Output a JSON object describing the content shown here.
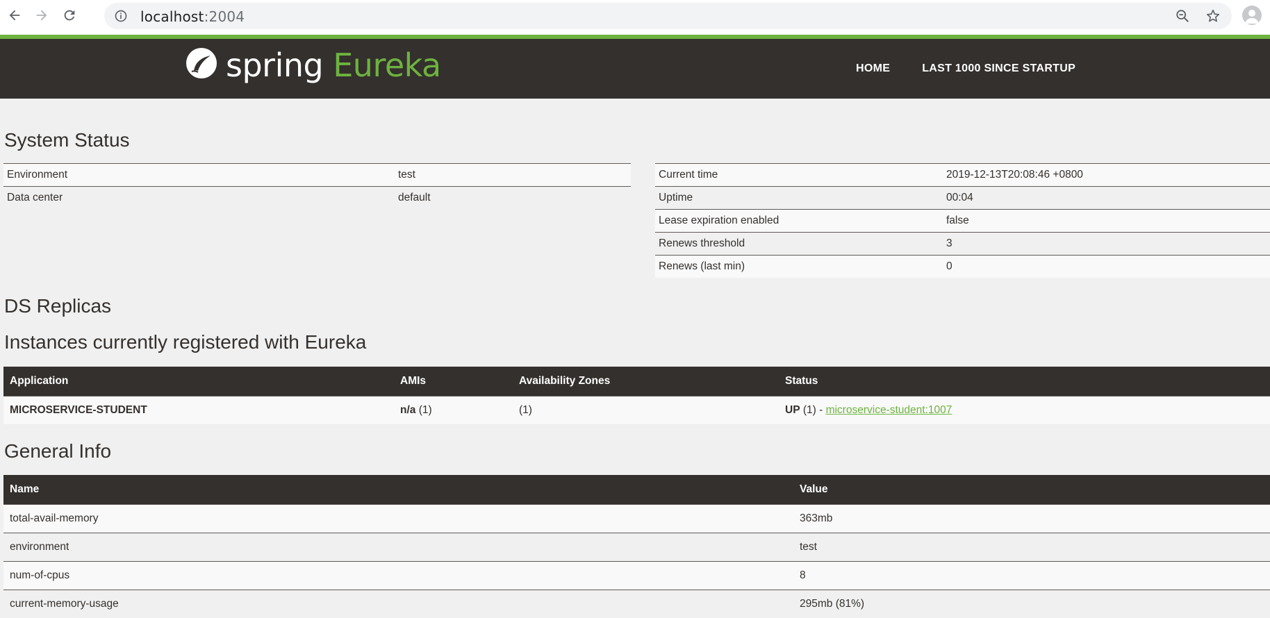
{
  "browser": {
    "url_host": "localhost",
    "url_port": ":2004"
  },
  "navbar": {
    "brand_spring": "spring",
    "brand_eureka": "Eureka",
    "links": [
      "HOME",
      "LAST 1000 SINCE STARTUP"
    ]
  },
  "system_status": {
    "title": "System Status",
    "left": [
      {
        "label": "Environment",
        "value": "test"
      },
      {
        "label": "Data center",
        "value": "default"
      }
    ],
    "right": [
      {
        "label": "Current time",
        "value": "2019-12-13T20:08:46 +0800"
      },
      {
        "label": "Uptime",
        "value": "00:04"
      },
      {
        "label": "Lease expiration enabled",
        "value": "false"
      },
      {
        "label": "Renews threshold",
        "value": "3"
      },
      {
        "label": "Renews (last min)",
        "value": "0"
      }
    ]
  },
  "ds_replicas": {
    "title": "DS Replicas"
  },
  "instances": {
    "title": "Instances currently registered with Eureka",
    "headers": [
      "Application",
      "AMIs",
      "Availability Zones",
      "Status"
    ],
    "rows": [
      {
        "application": "MICROSERVICE-STUDENT",
        "ami_bold": "n/a",
        "ami_count": " (1)",
        "zones": "(1)",
        "status_bold": "UP",
        "status_rest": " (1) - ",
        "status_link": "microservice-student:1007"
      }
    ]
  },
  "general_info": {
    "title": "General Info",
    "headers": [
      "Name",
      "Value"
    ],
    "rows": [
      {
        "name": "total-avail-memory",
        "value": "363mb"
      },
      {
        "name": "environment",
        "value": "test"
      },
      {
        "name": "num-of-cpus",
        "value": "8"
      },
      {
        "name": "current-memory-usage",
        "value": "295mb (81%)"
      }
    ]
  },
  "colors": {
    "navbar_bg": "#34302d",
    "accent_green": "#6db33f",
    "page_bg": "#f0f0f0"
  },
  "icons": [
    "back-icon",
    "forward-icon",
    "reload-icon",
    "info-icon",
    "zoom-icon",
    "star-icon",
    "profile-icon",
    "spring-leaf-icon"
  ]
}
